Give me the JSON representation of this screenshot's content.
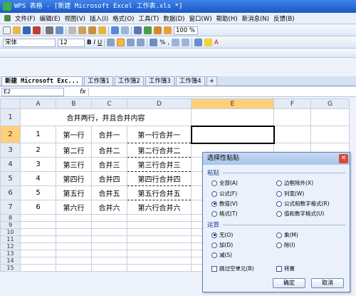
{
  "window": {
    "title": "WPS 表格 - [新建 Microsoft Excel 工作表.xls *]"
  },
  "menu": [
    "文件(F)",
    "编辑(E)",
    "视图(V)",
    "插入(I)",
    "格式(O)",
    "工具(T)",
    "数据(D)",
    "窗口(W)",
    "帮助(H)",
    "新消息(N)",
    "反馈(B)"
  ],
  "toolbar": {
    "zoom": "100 %",
    "font": "宋体",
    "size": "12"
  },
  "tabs": [
    "新建 Microsoft Exc...",
    "工作簿1",
    "工作簿2",
    "工作簿3",
    "工作簿4"
  ],
  "formula": {
    "name_box": "E2",
    "fx": "fx"
  },
  "sheet": {
    "columns": [
      "A",
      "B",
      "C",
      "D",
      "E",
      "F",
      "G"
    ],
    "title_row": "合并两行，并且合并内容",
    "rows": [
      [
        "1",
        "第一行",
        "合并一",
        "第一行合并一"
      ],
      [
        "2",
        "第二行",
        "合并二",
        "第二行合并二"
      ],
      [
        "3",
        "第三行",
        "合并三",
        "第三行合并三"
      ],
      [
        "4",
        "第四行",
        "合并四",
        "第四行合并四"
      ],
      [
        "5",
        "第五行",
        "合并五",
        "第五行合并五"
      ],
      [
        "6",
        "第六行",
        "合并六",
        "第六行合并六"
      ]
    ],
    "row_numbers": [
      "1",
      "2",
      "3",
      "4",
      "5",
      "6",
      "7",
      "8",
      "9",
      "10",
      "11",
      "12",
      "13",
      "14",
      "15"
    ]
  },
  "dialog": {
    "title": "选择性粘贴",
    "paste_label": "粘贴",
    "paste_left": [
      "全部(A)",
      "公式(F)",
      "数值(V)",
      "格式(T)"
    ],
    "paste_right": [
      "边框除外(X)",
      "列宽(W)",
      "公式和数字格式(R)",
      "值和数字格式(U)"
    ],
    "op_label": "运算",
    "op_left": [
      "无(O)",
      "加(D)",
      "减(S)"
    ],
    "op_right": [
      "乘(M)",
      "除(I)"
    ],
    "skip_blanks": "跳过空单元(B)",
    "transpose": "转置",
    "ok": "确定",
    "cancel": "取消"
  },
  "colors": {
    "accent": "#1b56c6",
    "selection": "#ffcf7a"
  }
}
